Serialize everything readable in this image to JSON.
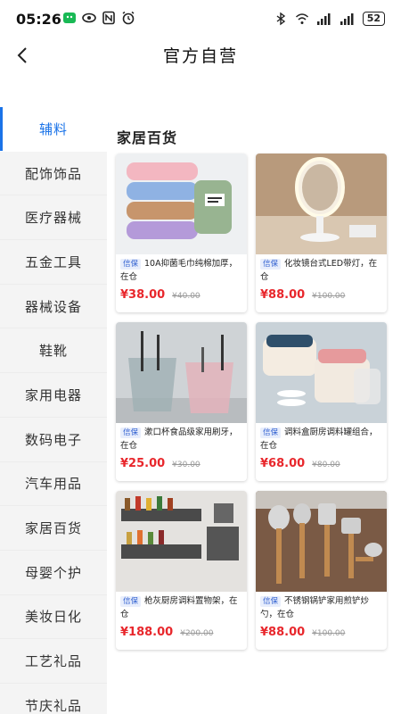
{
  "status_bar": {
    "time": "05:26",
    "battery": "52",
    "left_icons": [
      "wechat-icon",
      "eye-icon",
      "nfc-icon",
      "alarm-icon"
    ],
    "right_icons": [
      "bluetooth-icon",
      "wifi-icon",
      "signal-icon",
      "signal-icon"
    ]
  },
  "header": {
    "title": "官方自营"
  },
  "sidebar": {
    "items": [
      {
        "label": "辅料",
        "active": true
      },
      {
        "label": "配饰饰品"
      },
      {
        "label": "医疗器械"
      },
      {
        "label": "五金工具"
      },
      {
        "label": "器械设备"
      },
      {
        "label": "鞋靴"
      },
      {
        "label": "家用电器"
      },
      {
        "label": "数码电子"
      },
      {
        "label": "汽车用品"
      },
      {
        "label": "家居百货"
      },
      {
        "label": "母婴个护"
      },
      {
        "label": "美妆日化"
      },
      {
        "label": "工艺礼品"
      },
      {
        "label": "节庆礼品"
      }
    ]
  },
  "section": {
    "title": "家居百货"
  },
  "products": [
    {
      "tag": "信保",
      "name": "10A抑菌毛巾纯棉加厚，在仓",
      "price": "¥38.00",
      "old_price": "¥40.00"
    },
    {
      "tag": "信保",
      "name": "化妆镜台式LED带灯，在仓",
      "price": "¥88.00",
      "old_price": "¥100.00"
    },
    {
      "tag": "信保",
      "name": "漱口杯食品级家用刷牙，在仓",
      "price": "¥25.00",
      "old_price": "¥30.00"
    },
    {
      "tag": "信保",
      "name": "调料盒厨房调料罐组合，在仓",
      "price": "¥68.00",
      "old_price": "¥80.00"
    },
    {
      "tag": "信保",
      "name": "枪灰厨房调料置物架，在仓",
      "price": "¥188.00",
      "old_price": "¥200.00"
    },
    {
      "tag": "信保",
      "name": "不锈钢锅铲家用煎铲炒勺，在仓",
      "price": "¥88.00",
      "old_price": "¥100.00"
    }
  ],
  "colors": {
    "accent": "#1a73e8",
    "price": "#e8272c",
    "sidebar_bg": "#f4f4f4"
  }
}
